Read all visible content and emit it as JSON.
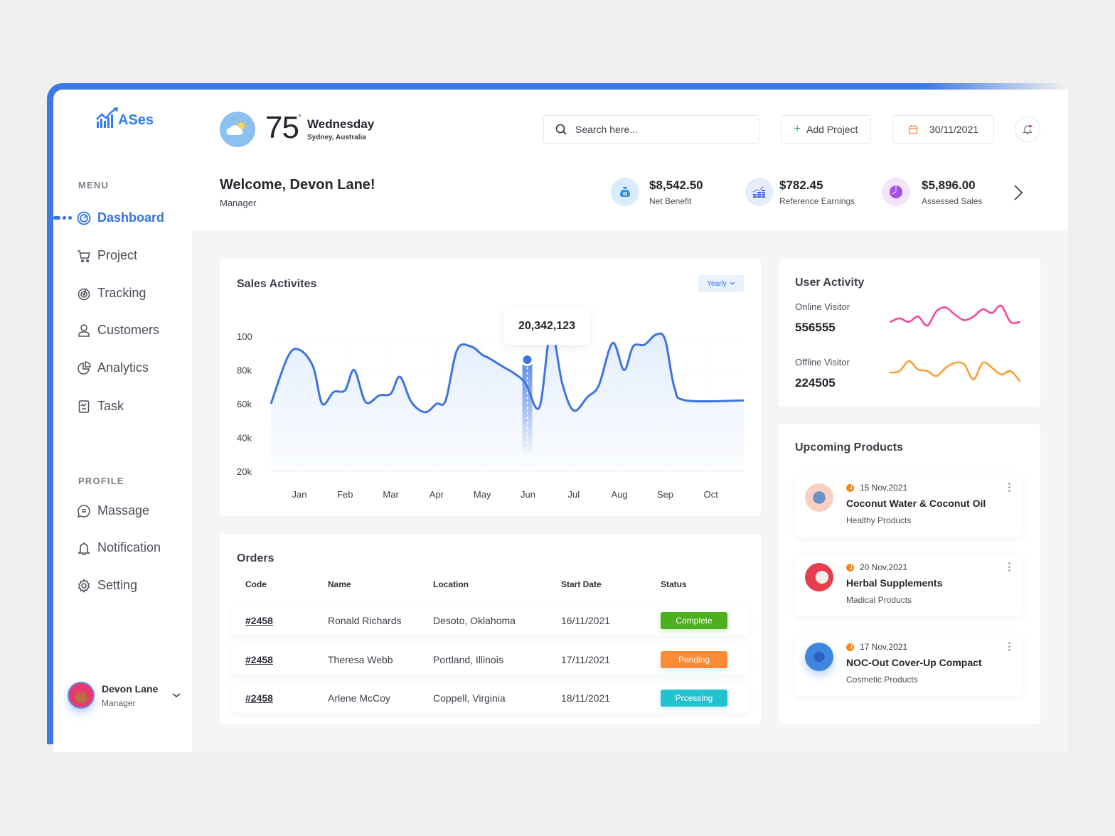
{
  "app": {
    "logo_text": "ASes",
    "brand_color": "#3373e0"
  },
  "sidebar": {
    "menu_label": "MENU",
    "menu_items": [
      {
        "label": "Dashboard",
        "icon": "gauge-icon",
        "active": true
      },
      {
        "label": "Project",
        "icon": "cart-icon",
        "active": false
      },
      {
        "label": "Tracking",
        "icon": "radar-icon",
        "active": false
      },
      {
        "label": "Customers",
        "icon": "user-icon",
        "active": false
      },
      {
        "label": "Analytics",
        "icon": "pie-chart-icon",
        "active": false
      },
      {
        "label": "Task",
        "icon": "clipboard-icon",
        "active": false
      }
    ],
    "profile_label": "PROFILE",
    "profile_items": [
      {
        "label": "Massage",
        "icon": "message-icon"
      },
      {
        "label": "Notification",
        "icon": "bell-icon"
      },
      {
        "label": "Setting",
        "icon": "gear-icon"
      }
    ],
    "user": {
      "name": "Devon Lane",
      "role": "Manager"
    }
  },
  "header": {
    "weather": {
      "temp": "75",
      "degree": "°",
      "day": "Wednesday",
      "location": "Sydney, Australia",
      "icon": "partly-cloudy-icon"
    },
    "search": {
      "placeholder": "Search here...",
      "value": ""
    },
    "add_project_label": "Add Project",
    "date": "30/11/2021",
    "welcome": "Welcome, Devon Lane!",
    "role": "Manager",
    "stats": [
      {
        "value": "$8,542.50",
        "label": "Net Benefit",
        "icon": "money-bag-icon",
        "color": "#2e8ee8",
        "bg": "#d9ecfb"
      },
      {
        "value": "$782.45",
        "label": "Reference Earnings",
        "icon": "growth-chart-icon",
        "color": "#3a5fe0",
        "bg": "#e7ecfb"
      },
      {
        "value": "$5,896.00",
        "label": "Assessed Sales",
        "icon": "pie-icon",
        "color": "#a74fe6",
        "bg": "#f3e6fb"
      }
    ]
  },
  "sales": {
    "title": "Sales Activites",
    "period": "Yearly",
    "tooltip_value": "20,342,123"
  },
  "chart_data": {
    "type": "area",
    "title": "Sales Activites",
    "xlabel": "",
    "ylabel": "",
    "categories": [
      "Jan",
      "Feb",
      "Mar",
      "Apr",
      "May",
      "Jun",
      "Jul",
      "Aug",
      "Sep",
      "Oct"
    ],
    "y_tick_labels": [
      "100",
      "80k",
      "60k",
      "40k",
      "20k"
    ],
    "y_ticks": [
      100000,
      80000,
      60000,
      40000,
      20000
    ],
    "ylim": [
      20000,
      100000
    ],
    "grid": true,
    "series": [
      {
        "name": "Sales",
        "color": "#3f74e0",
        "x": [
          0.35,
          0.75,
          1.0,
          1.3,
          1.5,
          1.75,
          2.0,
          2.2,
          2.45,
          2.75,
          3.0,
          3.2,
          3.45,
          3.75,
          4.0,
          4.2,
          4.45,
          4.75,
          5.0,
          5.15,
          5.45,
          5.7,
          5.95,
          6.25,
          6.5,
          6.75,
          7.0,
          7.3,
          7.55,
          7.85,
          8.1,
          8.3,
          8.55,
          8.8,
          9.0,
          9.2,
          9.45,
          9.7
        ],
        "values": [
          60000,
          88000,
          92000,
          82000,
          60000,
          67000,
          68000,
          80000,
          61000,
          65000,
          66000,
          76000,
          61000,
          55000,
          60000,
          62000,
          92000,
          94000,
          89000,
          87000,
          82000,
          78000,
          72000,
          58000,
          103000,
          72000,
          56000,
          64000,
          71000,
          96000,
          80000,
          94000,
          95000,
          101000,
          98000,
          70000,
          62000,
          62000
        ]
      }
    ],
    "highlight": {
      "category": "Jun",
      "value_label": "20,342,123"
    }
  },
  "orders": {
    "title": "Orders",
    "columns": [
      "Code",
      "Name",
      "Location",
      "Start Date",
      "Status"
    ],
    "rows": [
      {
        "code": "#2458",
        "name": "Ronald Richards",
        "location": "Desoto, Oklahoma",
        "date": "16/11/2021",
        "status": "Complete",
        "status_color": "#4caf1e"
      },
      {
        "code": "#2458",
        "name": "Theresa Webb",
        "location": "Portland, Illinois",
        "date": "17/11/2021",
        "status": "Pending",
        "status_color": "#fb8c35"
      },
      {
        "code": "#2458",
        "name": "Arlene McCoy",
        "location": "Coppell, Virginia",
        "date": "18/11/2021",
        "status": "Prcessing",
        "status_color": "#22c3cf"
      }
    ]
  },
  "user_activity": {
    "title": "User Activity",
    "online": {
      "label": "Online Visitor",
      "value": "556555",
      "color": "#f1318f",
      "trend": [
        4,
        6,
        4,
        7,
        2,
        10,
        12,
        8,
        5,
        7,
        11,
        9,
        13,
        4,
        4
      ]
    },
    "offline": {
      "label": "Offline Visitor",
      "value": "224505",
      "color": "#f7941d",
      "trend": [
        6,
        7,
        13,
        8,
        7,
        4,
        9,
        12,
        11,
        2,
        12,
        9,
        5,
        7,
        1
      ]
    }
  },
  "upcoming": {
    "title": "Upcoming Products",
    "items": [
      {
        "date": "15 Nov,2021",
        "name": "Coconut Water & Coconut Oil",
        "category": "Healthy Products",
        "thumb_color": "#f9cfc3"
      },
      {
        "date": "20 Nov,2021",
        "name": "Herbal Supplements",
        "category": "Madical Products",
        "thumb_color": "#e63d4f"
      },
      {
        "date": "17 Nov,2021",
        "name": "NOC-Out Cover-Up Compact",
        "category": "Cosmetic Products",
        "thumb_color": "#3f86e0"
      }
    ]
  }
}
